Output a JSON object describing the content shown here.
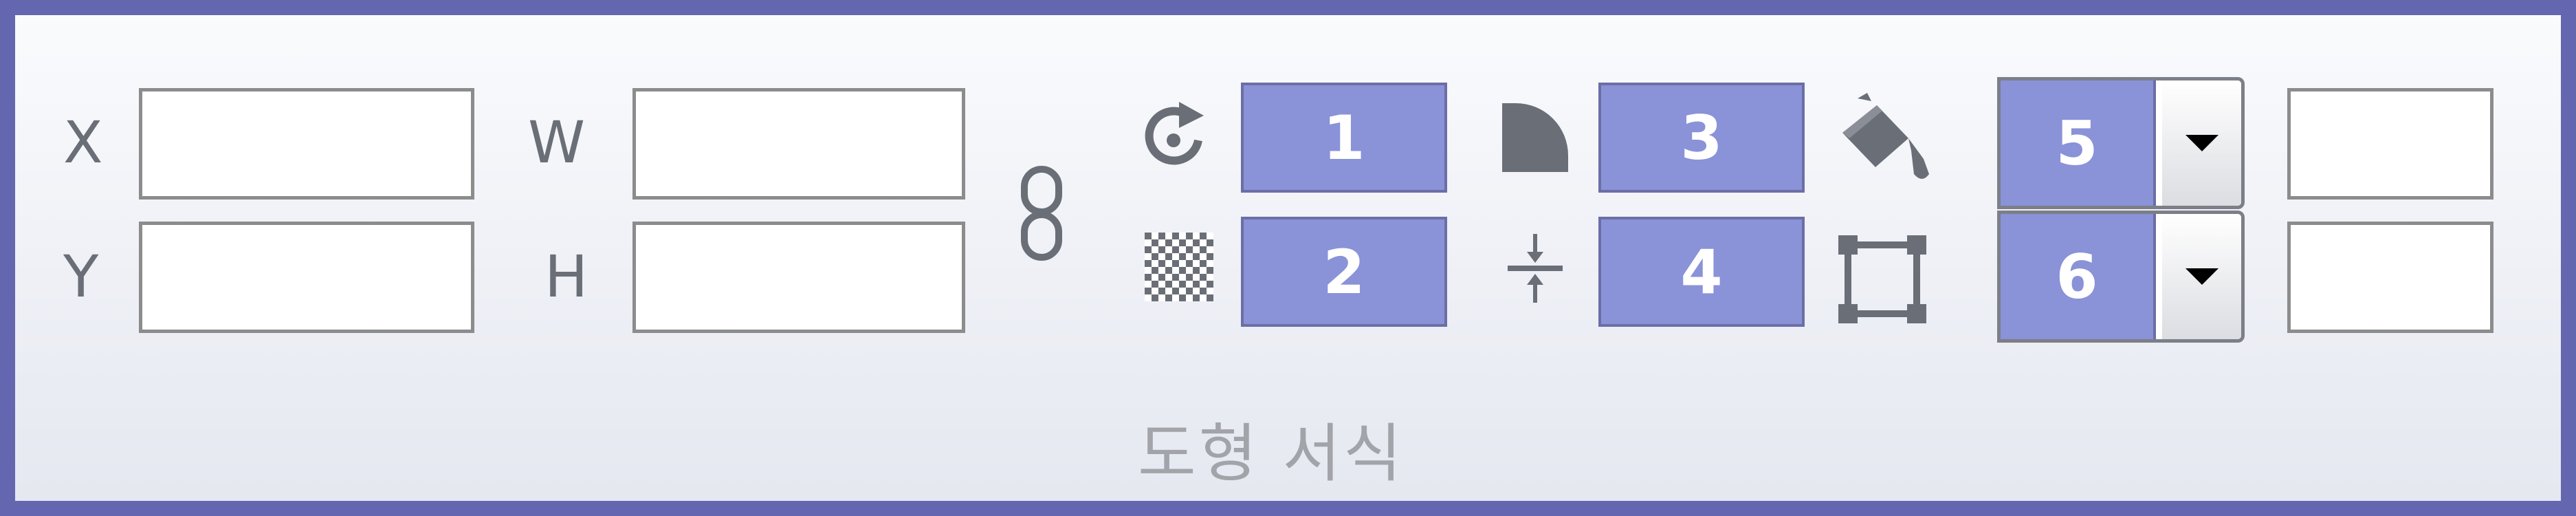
{
  "position_size": {
    "x_label": "X",
    "y_label": "Y",
    "w_label": "W",
    "h_label": "H",
    "x_value": "",
    "y_value": "",
    "w_value": "",
    "h_value": ""
  },
  "numbered_boxes": {
    "rotation": "1",
    "transparency": "2",
    "corner_radius": "3",
    "spacing": "4",
    "fill_combo": "5",
    "border_combo": "6"
  },
  "extra_fields": {
    "fill_value": "",
    "border_value": ""
  },
  "group": {
    "caption": "도형 서식"
  },
  "icons": {
    "lock": "chain-link-icon",
    "rotate": "rotate-icon",
    "transparency": "checkerboard-icon",
    "corner": "quarter-circle-icon",
    "spacing": "spacing-arrows-icon",
    "fill": "paint-bucket-icon",
    "border": "border-square-icon",
    "dropdown": "chevron-down-icon"
  },
  "colors": {
    "frame": "#6466b0",
    "highlight_box": "#8a92d8"
  }
}
